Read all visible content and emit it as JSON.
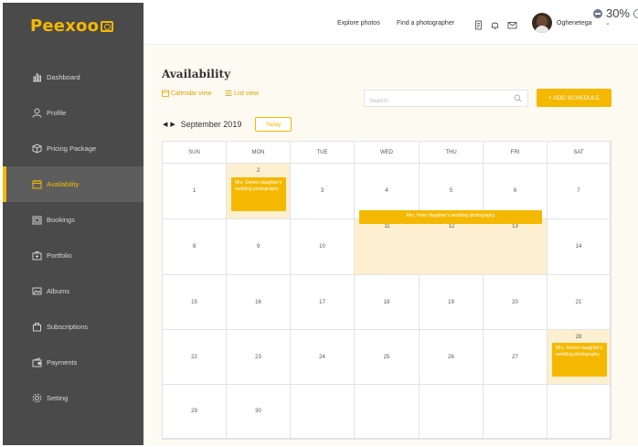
{
  "brand": {
    "name": "Peexoo",
    "logo_color": "#f5b800",
    "accent": "#f5b800"
  },
  "sidebar": {
    "items": [
      {
        "label": "Dashboard",
        "icon": "bar-chart-icon",
        "active": false
      },
      {
        "label": "Profile",
        "icon": "user-icon",
        "active": false
      },
      {
        "label": "Pricing Package",
        "icon": "package-icon",
        "active": false
      },
      {
        "label": "Availability",
        "icon": "calendar-icon",
        "active": true
      },
      {
        "label": "Bookings",
        "icon": "bookings-icon",
        "active": false
      },
      {
        "label": "Portfolio",
        "icon": "portfolio-icon",
        "active": false
      },
      {
        "label": "Albums",
        "icon": "album-icon",
        "active": false
      },
      {
        "label": "Subscriptions",
        "icon": "bag-icon",
        "active": false
      },
      {
        "label": "Payments",
        "icon": "wallet-icon",
        "active": false
      },
      {
        "label": "Setting",
        "icon": "gear-icon",
        "active": false
      }
    ]
  },
  "header": {
    "links": [
      "Explore photos",
      "Find a photographer"
    ],
    "username": "Oghenetega",
    "zoom": "30%"
  },
  "main": {
    "title": "Availability",
    "views": [
      "Calendar view",
      "List view"
    ],
    "search_placeholder": "Search",
    "add_button": "+ ADD SCHEDULE",
    "month": "September 2019",
    "today": "Today"
  },
  "calendar": {
    "weekdays": [
      "SUN",
      "MON",
      "TUE",
      "WED",
      "THU",
      "FRI",
      "SAT"
    ],
    "weeks": [
      [
        "1",
        "2",
        "3",
        "4",
        "5",
        "6",
        "7"
      ],
      [
        "8",
        "9",
        "10",
        "11",
        "12",
        "13",
        "14"
      ],
      [
        "15",
        "16",
        "17",
        "18",
        "19",
        "20",
        "21"
      ],
      [
        "22",
        "23",
        "24",
        "25",
        "26",
        "27",
        "28"
      ],
      [
        "29",
        "30",
        "",
        "",
        "",
        "",
        ""
      ]
    ],
    "events": [
      {
        "text": "Mrs. Steven daughter's wedding photography",
        "date": "2019-09-02"
      },
      {
        "text": "Mrs. Peter daughter's wedding photography",
        "start": "2019-09-11",
        "end": "2019-09-13"
      },
      {
        "text": "Mrs. Steven daughter's wedding photography",
        "date": "2019-09-28"
      }
    ]
  }
}
